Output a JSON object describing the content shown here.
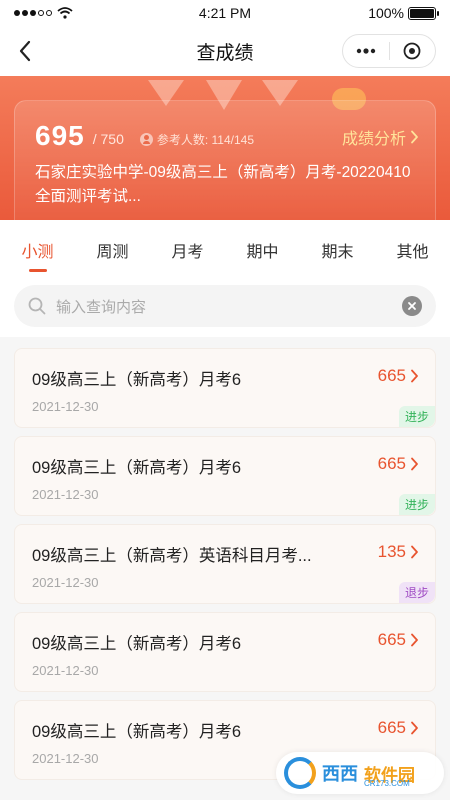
{
  "status_bar": {
    "time": "4:21 PM",
    "battery_text": "100%",
    "signal_icon": "signal-dots-icon",
    "wifi_icon": "wifi-icon",
    "battery_icon": "battery-icon",
    "battery_level": 1.0
  },
  "nav": {
    "title": "查成绩",
    "back_icon": "chevron-left-icon",
    "more_icon": "more-icon",
    "target_icon": "target-icon"
  },
  "score": {
    "value": "695",
    "total": "/ 750",
    "participants": "参考人数: 114/145",
    "analysis_label": "成绩分析",
    "exam_title": "石家庄实验中学-09级高三上（新高考）月考-20220410全面测评考试..."
  },
  "tabs": [
    {
      "label": "小测",
      "active": true
    },
    {
      "label": "周测",
      "active": false
    },
    {
      "label": "月考",
      "active": false
    },
    {
      "label": "期中",
      "active": false
    },
    {
      "label": "期末",
      "active": false
    },
    {
      "label": "其他",
      "active": false
    }
  ],
  "search": {
    "placeholder": "输入查询内容"
  },
  "items": [
    {
      "title": "09级高三上（新高考）月考6",
      "date": "2021-12-30",
      "score": "665",
      "badge": "进步",
      "badge_type": "up"
    },
    {
      "title": "09级高三上（新高考）月考6",
      "date": "2021-12-30",
      "score": "665",
      "badge": "进步",
      "badge_type": "up"
    },
    {
      "title": "09级高三上（新高考）英语科目月考...",
      "date": "2021-12-30",
      "score": "135",
      "badge": "退步",
      "badge_type": "down"
    },
    {
      "title": "09级高三上（新高考）月考6",
      "date": "2021-12-30",
      "score": "665",
      "badge": "",
      "badge_type": ""
    },
    {
      "title": "09级高三上（新高考）月考6",
      "date": "2021-12-30",
      "score": "665",
      "badge": "",
      "badge_type": ""
    }
  ],
  "watermark": {
    "text_a": "西西",
    "text_b": "软件园",
    "sub": "CR173.COM"
  },
  "colors": {
    "accent": "#e8542f",
    "header_top": "#f47c5a",
    "header_bottom": "#ea5a3b",
    "analysis": "#ffe39a",
    "progress_up": "#34b35a",
    "progress_down": "#a04cc4"
  }
}
